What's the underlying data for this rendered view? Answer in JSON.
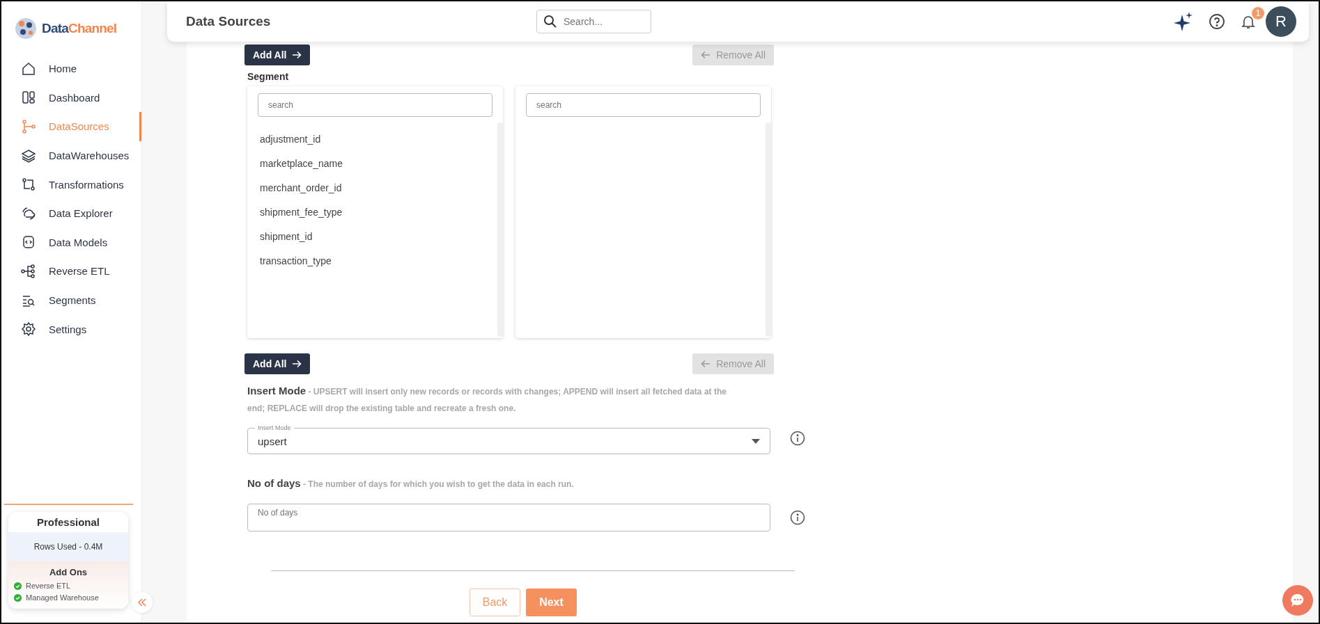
{
  "sidebar": {
    "logo": {
      "first": "Data",
      "second": "Channel"
    },
    "items": [
      {
        "label": "Home",
        "selected": false
      },
      {
        "label": "Dashboard",
        "selected": false
      },
      {
        "label": "DataSources",
        "selected": true
      },
      {
        "label": "DataWarehouses",
        "selected": false
      },
      {
        "label": "Transformations",
        "selected": false
      },
      {
        "label": "Data Explorer",
        "selected": false
      },
      {
        "label": "Data Models",
        "selected": false
      },
      {
        "label": "Reverse ETL",
        "selected": false
      },
      {
        "label": "Segments",
        "selected": false
      },
      {
        "label": "Settings",
        "selected": false
      }
    ],
    "plan": {
      "name": "Professional",
      "rows_used": "Rows Used - 0.4M",
      "addons_title": "Add Ons",
      "addons": [
        {
          "label": "Reverse ETL",
          "active": true
        },
        {
          "label": "Managed Warehouse",
          "active": true
        }
      ]
    }
  },
  "header": {
    "title": "Data Sources",
    "search": {
      "placeholder": "Search..."
    },
    "notification_count": "1",
    "avatar": "R"
  },
  "top_actions": [
    {
      "label": "Add All",
      "kind": "add",
      "disabled": false
    },
    {
      "label": "Remove All",
      "kind": "remove",
      "disabled": true
    }
  ],
  "segment": {
    "label": "Segment",
    "available": {
      "placeholder": "search",
      "items": [
        "adjustment_id",
        "marketplace_name",
        "merchant_order_id",
        "shipment_fee_type",
        "shipment_id",
        "transaction_type"
      ]
    },
    "chosen": {
      "placeholder": "search"
    }
  },
  "bottom_actions": [
    {
      "label": "Add All",
      "kind": "add",
      "disabled": false
    },
    {
      "label": "Remove All",
      "kind": "remove",
      "disabled": true
    }
  ],
  "insert_mode": {
    "text": "**Insert Mode** - UPSERT will insert only new records or records with changes; APPEND will insert all fetched data at the end; REPLACE will drop the existing table and recreate a fresh one.",
    "field_label": "Insert Mode",
    "value": "upsert"
  },
  "no_of_days": {
    "text": "**No of days** - The number of days for which you wish to get the data in each run.",
    "placeholder": "No of days"
  },
  "footer": [
    {
      "label": "Back",
      "kind": "secondary"
    },
    {
      "label": "Next",
      "kind": "primary"
    }
  ]
}
